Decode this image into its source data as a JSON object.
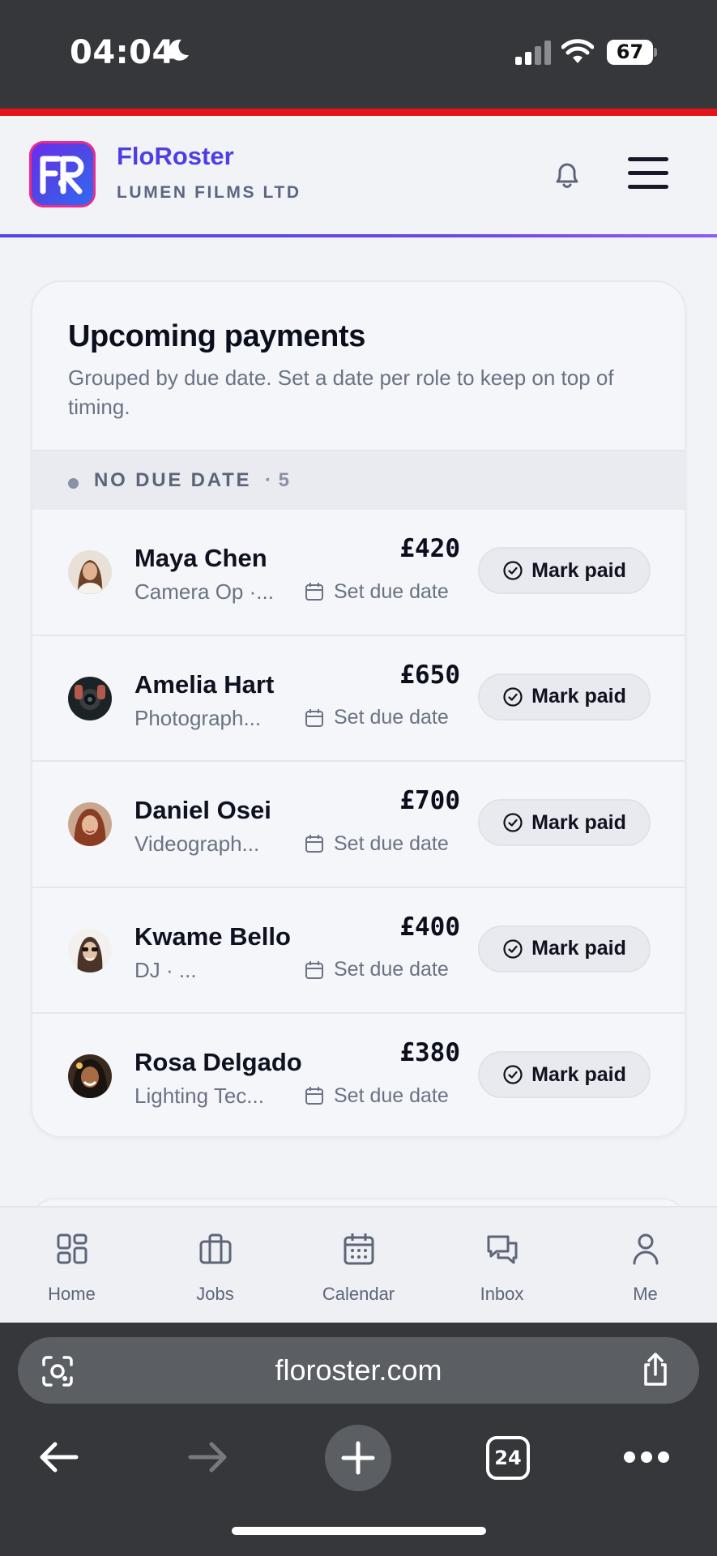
{
  "status_bar": {
    "time": "04:04",
    "battery": "67",
    "icons": [
      "moon-icon",
      "signal-icon",
      "wifi-icon",
      "battery-icon"
    ]
  },
  "header": {
    "app_name": "FloRoster",
    "org_name": "LUMEN FILMS LTD",
    "icons": [
      "app-logo",
      "bell-icon",
      "hamburger-menu-icon"
    ]
  },
  "payments": {
    "title": "Upcoming payments",
    "subtitle": "Grouped by due date. Set a date per role to keep on top of timing.",
    "group": {
      "label": "NO DUE DATE",
      "count": "· 5"
    },
    "due_label": "Set due date",
    "action_label": "Mark paid",
    "rows": [
      {
        "name": "Maya Chen",
        "role": "Camera Op ·...",
        "amount": "£420"
      },
      {
        "name": "Amelia Hart",
        "role": "Photograph...",
        "amount": "£650"
      },
      {
        "name": "Daniel Osei",
        "role": "Videograph...",
        "amount": "£700"
      },
      {
        "name": "Kwame Bello",
        "role": "DJ · ...",
        "amount": "£400"
      },
      {
        "name": "Rosa Delgado",
        "role": "Lighting Tec...",
        "amount": "£380"
      }
    ]
  },
  "bottom_nav": {
    "items": [
      {
        "label": "Home",
        "icon": "grid-icon"
      },
      {
        "label": "Jobs",
        "icon": "briefcase-icon"
      },
      {
        "label": "Calendar",
        "icon": "calendar-icon"
      },
      {
        "label": "Inbox",
        "icon": "chat-icon"
      },
      {
        "label": "Me",
        "icon": "user-icon"
      }
    ]
  },
  "browser": {
    "url": "floroster.com",
    "tab_count": "24",
    "icons": [
      "lens-icon",
      "share-icon",
      "back-arrow-icon",
      "forward-arrow-icon",
      "plus-icon",
      "tabs-icon",
      "more-icon"
    ]
  },
  "colors": {
    "brand": "#4f3ee6",
    "status_bar": "#35373b",
    "accent_line": "#e4141a"
  }
}
